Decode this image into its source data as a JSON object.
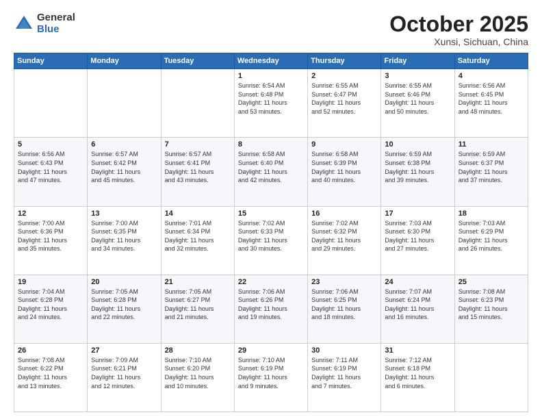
{
  "header": {
    "logo_general": "General",
    "logo_blue": "Blue",
    "title": "October 2025",
    "subtitle": "Xunsi, Sichuan, China"
  },
  "weekdays": [
    "Sunday",
    "Monday",
    "Tuesday",
    "Wednesday",
    "Thursday",
    "Friday",
    "Saturday"
  ],
  "weeks": [
    [
      {
        "day": "",
        "info": ""
      },
      {
        "day": "",
        "info": ""
      },
      {
        "day": "",
        "info": ""
      },
      {
        "day": "1",
        "info": "Sunrise: 6:54 AM\nSunset: 6:48 PM\nDaylight: 11 hours\nand 53 minutes."
      },
      {
        "day": "2",
        "info": "Sunrise: 6:55 AM\nSunset: 6:47 PM\nDaylight: 11 hours\nand 52 minutes."
      },
      {
        "day": "3",
        "info": "Sunrise: 6:55 AM\nSunset: 6:46 PM\nDaylight: 11 hours\nand 50 minutes."
      },
      {
        "day": "4",
        "info": "Sunrise: 6:56 AM\nSunset: 6:45 PM\nDaylight: 11 hours\nand 48 minutes."
      }
    ],
    [
      {
        "day": "5",
        "info": "Sunrise: 6:56 AM\nSunset: 6:43 PM\nDaylight: 11 hours\nand 47 minutes."
      },
      {
        "day": "6",
        "info": "Sunrise: 6:57 AM\nSunset: 6:42 PM\nDaylight: 11 hours\nand 45 minutes."
      },
      {
        "day": "7",
        "info": "Sunrise: 6:57 AM\nSunset: 6:41 PM\nDaylight: 11 hours\nand 43 minutes."
      },
      {
        "day": "8",
        "info": "Sunrise: 6:58 AM\nSunset: 6:40 PM\nDaylight: 11 hours\nand 42 minutes."
      },
      {
        "day": "9",
        "info": "Sunrise: 6:58 AM\nSunset: 6:39 PM\nDaylight: 11 hours\nand 40 minutes."
      },
      {
        "day": "10",
        "info": "Sunrise: 6:59 AM\nSunset: 6:38 PM\nDaylight: 11 hours\nand 39 minutes."
      },
      {
        "day": "11",
        "info": "Sunrise: 6:59 AM\nSunset: 6:37 PM\nDaylight: 11 hours\nand 37 minutes."
      }
    ],
    [
      {
        "day": "12",
        "info": "Sunrise: 7:00 AM\nSunset: 6:36 PM\nDaylight: 11 hours\nand 35 minutes."
      },
      {
        "day": "13",
        "info": "Sunrise: 7:00 AM\nSunset: 6:35 PM\nDaylight: 11 hours\nand 34 minutes."
      },
      {
        "day": "14",
        "info": "Sunrise: 7:01 AM\nSunset: 6:34 PM\nDaylight: 11 hours\nand 32 minutes."
      },
      {
        "day": "15",
        "info": "Sunrise: 7:02 AM\nSunset: 6:33 PM\nDaylight: 11 hours\nand 30 minutes."
      },
      {
        "day": "16",
        "info": "Sunrise: 7:02 AM\nSunset: 6:32 PM\nDaylight: 11 hours\nand 29 minutes."
      },
      {
        "day": "17",
        "info": "Sunrise: 7:03 AM\nSunset: 6:30 PM\nDaylight: 11 hours\nand 27 minutes."
      },
      {
        "day": "18",
        "info": "Sunrise: 7:03 AM\nSunset: 6:29 PM\nDaylight: 11 hours\nand 26 minutes."
      }
    ],
    [
      {
        "day": "19",
        "info": "Sunrise: 7:04 AM\nSunset: 6:28 PM\nDaylight: 11 hours\nand 24 minutes."
      },
      {
        "day": "20",
        "info": "Sunrise: 7:05 AM\nSunset: 6:28 PM\nDaylight: 11 hours\nand 22 minutes."
      },
      {
        "day": "21",
        "info": "Sunrise: 7:05 AM\nSunset: 6:27 PM\nDaylight: 11 hours\nand 21 minutes."
      },
      {
        "day": "22",
        "info": "Sunrise: 7:06 AM\nSunset: 6:26 PM\nDaylight: 11 hours\nand 19 minutes."
      },
      {
        "day": "23",
        "info": "Sunrise: 7:06 AM\nSunset: 6:25 PM\nDaylight: 11 hours\nand 18 minutes."
      },
      {
        "day": "24",
        "info": "Sunrise: 7:07 AM\nSunset: 6:24 PM\nDaylight: 11 hours\nand 16 minutes."
      },
      {
        "day": "25",
        "info": "Sunrise: 7:08 AM\nSunset: 6:23 PM\nDaylight: 11 hours\nand 15 minutes."
      }
    ],
    [
      {
        "day": "26",
        "info": "Sunrise: 7:08 AM\nSunset: 6:22 PM\nDaylight: 11 hours\nand 13 minutes."
      },
      {
        "day": "27",
        "info": "Sunrise: 7:09 AM\nSunset: 6:21 PM\nDaylight: 11 hours\nand 12 minutes."
      },
      {
        "day": "28",
        "info": "Sunrise: 7:10 AM\nSunset: 6:20 PM\nDaylight: 11 hours\nand 10 minutes."
      },
      {
        "day": "29",
        "info": "Sunrise: 7:10 AM\nSunset: 6:19 PM\nDaylight: 11 hours\nand 9 minutes."
      },
      {
        "day": "30",
        "info": "Sunrise: 7:11 AM\nSunset: 6:19 PM\nDaylight: 11 hours\nand 7 minutes."
      },
      {
        "day": "31",
        "info": "Sunrise: 7:12 AM\nSunset: 6:18 PM\nDaylight: 11 hours\nand 6 minutes."
      },
      {
        "day": "",
        "info": ""
      }
    ]
  ]
}
